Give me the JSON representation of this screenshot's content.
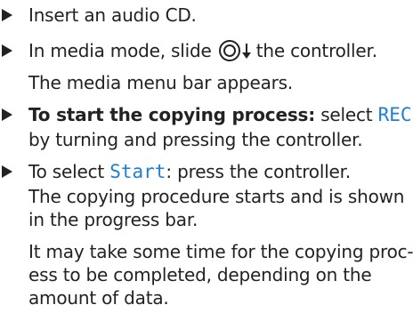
{
  "steps": [
    {
      "text": "Insert an audio CD."
    },
    {
      "before": "In media mode, slide",
      "after": "the controller.",
      "result": "The media menu bar appears."
    },
    {
      "bold": "To start the copying process:",
      "text_a": " select ",
      "highlight": "REC",
      "line2": "by turning and pressing the controller."
    },
    {
      "text_a": "To select ",
      "highlight": "Start",
      "text_b": ": press the controller.",
      "result_lines": [
        "The copying procedure starts and is shown",
        "in the progress bar."
      ]
    }
  ],
  "note_lines": [
    "It may take some time for the copying proc-",
    "ess to be completed, depending on the",
    "amount of data."
  ],
  "colors": {
    "highlight": "#1d7fd1",
    "text": "#222222"
  },
  "icons": {
    "bullet": "triangle-bullet-icon",
    "controller": "controller-slide-down-icon"
  }
}
